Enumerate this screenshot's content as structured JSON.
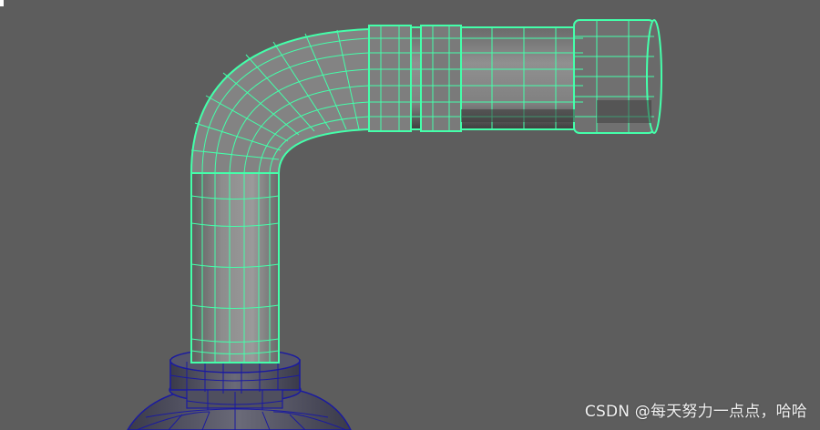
{
  "viewport": {
    "background_color": "#5d5d5d",
    "mesh_selected_color": "#44ffaa",
    "mesh_unselected_color": "#1a1aa0",
    "shading_color": "#8a8a8a"
  },
  "objects": [
    {
      "name": "pipe-elbow",
      "state": "selected"
    },
    {
      "name": "bottle",
      "state": "unselected"
    }
  ],
  "watermark": {
    "text": "CSDN @每天努力一点点，哈哈"
  }
}
